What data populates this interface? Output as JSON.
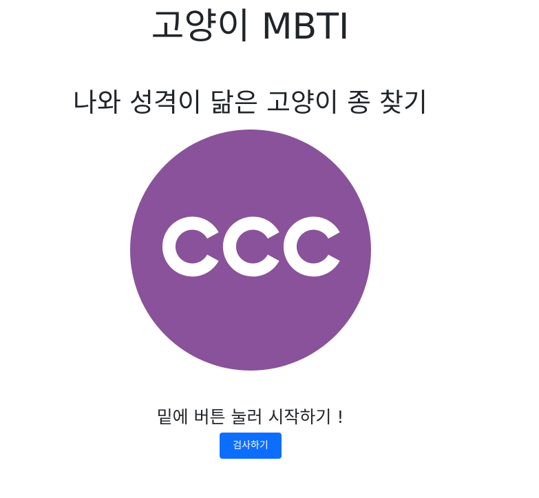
{
  "header": {
    "title": "고양이 MBTI",
    "subtitle": "나와 성격이 닮은 고양이 종 찾기"
  },
  "logo": {
    "text": "CCC",
    "background_color": "#8a529a",
    "letter_color": "#ffffff"
  },
  "intro": {
    "prompt": "밑에 버튼 눌러 시작하기 !",
    "start_button_label": "검사하기"
  },
  "colors": {
    "button": "#0d6efd",
    "text": "#212529"
  }
}
